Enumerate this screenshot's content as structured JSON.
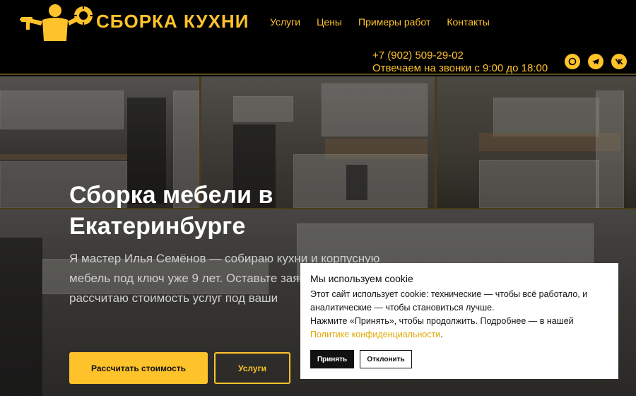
{
  "header": {
    "brand": "СБОРКА КУХНИ",
    "logo_icon": "worker-with-drill-icon",
    "nav": [
      "Услуги",
      "Цены",
      "Примеры работ",
      "Контакты"
    ],
    "phone": "+7 (902) 509-29-02",
    "hours": "Отвечаем на звонки с 9:00 до 18:00",
    "socials": [
      "whatsapp-icon",
      "telegram-icon",
      "vk-icon"
    ],
    "accent_color": "#fec22b"
  },
  "hero": {
    "title": "Сборка мебели в Екатеринбурге",
    "text": "Я мастер Илья Семёнов — собираю кухни и корпусную мебель под ключ уже 9 лет. Оставьте заявку, и я рассчитаю стоимость услуг под ваши",
    "primary_button": "Рассчитать стоимость",
    "secondary_button": "Услуги"
  },
  "cookie": {
    "title": "Мы используем cookie",
    "line1": "Этот сайт использует cookie: технические — чтобы всё работало, и аналитические — чтобы становиться лучше.",
    "line2_prefix": "Нажмите «Принять», чтобы продолжить. Подробнее — в нашей ",
    "link": "Политике конфиденциальности",
    "line2_suffix": ".",
    "accept": "Принять",
    "decline": "Отклонить"
  }
}
